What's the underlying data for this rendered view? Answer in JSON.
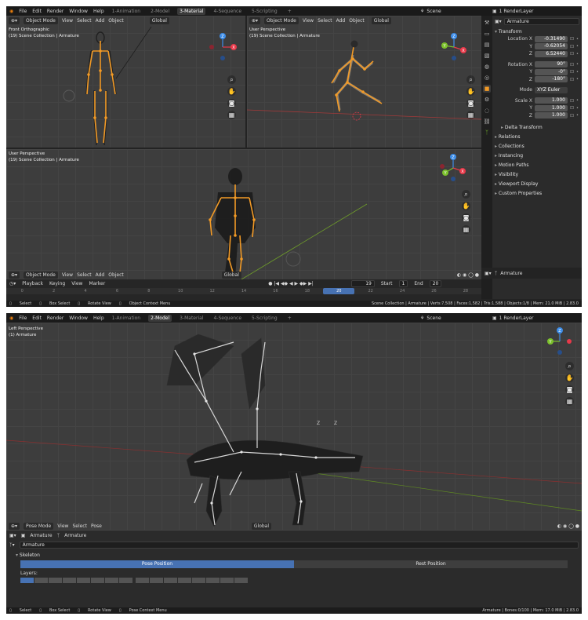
{
  "top": {
    "menus": [
      "File",
      "Edit",
      "Render",
      "Window",
      "Help"
    ],
    "workspaces1": [
      "1-Animation",
      "2-Model",
      "3-Material",
      "4-Sequence",
      "5-Scripting"
    ],
    "active_ws1": "3-Material",
    "active_ws2": "2-Model",
    "scene": "Scene",
    "render_layer": "1 RenderLayer",
    "plus": "+"
  },
  "vp": {
    "object_mode": "Object Mode",
    "pose_mode": "Pose Mode",
    "view": "View",
    "select": "Select",
    "add": "Add",
    "object": "Object",
    "pose": "Pose",
    "global": "Global",
    "front_ortho": "Front Orthographic",
    "user_persp": "User Perspective",
    "left_persp": "Left Perspective",
    "scene_coll": "(19) Scene Collection | Armature",
    "armature_1": "(1) Armature",
    "axis_z": "Z",
    "axis_y": "Y",
    "axis_x": "X"
  },
  "timeline": {
    "playback": "Playback",
    "keying": "Keying",
    "view": "View",
    "marker": "Marker",
    "frame": "19",
    "start_label": "Start",
    "start": "1",
    "end_label": "End",
    "end": "20",
    "ticks": [
      "0",
      "2",
      "4",
      "6",
      "8",
      "10",
      "12",
      "14",
      "16",
      "18",
      "20",
      "22",
      "24",
      "26",
      "28"
    ],
    "current_tick": "20"
  },
  "status1": {
    "select": "Select",
    "box_select": "Box Select",
    "rotate_view": "Rotate View",
    "context": "Object Context Menu",
    "stats": "Scene Collection | Armature | Verts:7,508 | Faces:1,582 | Tris:1,588 | Objects:1/8 | Mem: 21.0 MiB | 2.83.0"
  },
  "status2": {
    "select": "Select",
    "box_select": "Box Select",
    "rotate_view": "Rotate View",
    "context": "Pose Context Menu",
    "stats": "Armature | Bones:0/100 | Mem: 17.0 MiB | 2.83.0"
  },
  "props": {
    "object_name": "Armature",
    "transform": "Transform",
    "location_x_label": "Location X",
    "y_label": "Y",
    "z_label": "Z",
    "loc_x": "-0.31490",
    "loc_y": "-0.62054",
    "loc_z": "6.52440",
    "rotation_x_label": "Rotation X",
    "rot_x": "90°",
    "rot_y": "-0°",
    "rot_z": "-180°",
    "mode_label": "Mode",
    "mode": "XYZ Euler",
    "scale_x_label": "Scale X",
    "scale_x": "1.000",
    "scale_y": "1.000",
    "scale_z": "1.000",
    "delta": "Delta Transform",
    "sections": [
      "Relations",
      "Collections",
      "Instancing",
      "Motion Paths",
      "Visibility",
      "Viewport Display",
      "Custom Properties"
    ],
    "footer_name": "Armature"
  },
  "armature_panel": {
    "crumb1": "Armature",
    "crumb2": "Armature",
    "data_name": "Armature",
    "skeleton": "Skeleton",
    "pose_position": "Pose Position",
    "rest_position": "Rest Position",
    "layers": "Layers:"
  },
  "colors": {
    "accent": "#4772b3",
    "bone": "#f29a26",
    "axis_x": "#e8394a",
    "axis_y": "#7cc12c",
    "axis_z": "#3d8de8"
  }
}
